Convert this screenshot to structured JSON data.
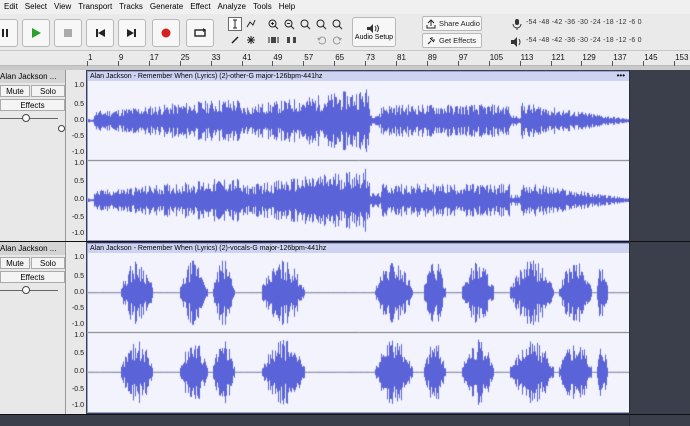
{
  "menu": [
    "Edit",
    "Select",
    "View",
    "Transport",
    "Tracks",
    "Generate",
    "Effect",
    "Analyze",
    "Tools",
    "Help"
  ],
  "menu_underline": [
    "E",
    "S",
    "V",
    "r",
    "T",
    "G",
    "c",
    "A",
    "o",
    "H"
  ],
  "toolbar": {
    "share_audio_label": "Share Audio",
    "get_effects_label": "Get Effects",
    "audio_setup_label": "Audio Setup",
    "meter_scale": "-54  -48  -42  -36  -30  -24  -18  -12   -6    0",
    "meter_scale2": "-54  -48  -42  -36  -30  -24  -18  -12   -6    0"
  },
  "ruler": {
    "labels": [
      "1",
      "9",
      "17",
      "25",
      "33",
      "41",
      "49",
      "57",
      "65",
      "73",
      "81",
      "89",
      "97",
      "105",
      "113",
      "121",
      "129",
      "137",
      "145",
      "153"
    ]
  },
  "tracks": [
    {
      "name": "Alan Jackson ...",
      "mute_label": "Mute",
      "solo_label": "Solo",
      "effects_label": "Effects",
      "clip_title": "Alan Jackson - Remember When (Lyrics) (2)-other-G major-126bpm-441hz",
      "scale": [
        "1.0",
        "0.5",
        "0.0",
        "-0.5",
        "-1.0"
      ],
      "scale2": [
        "1.0",
        "0.5",
        "0.0",
        "-0.5",
        "-1.0"
      ]
    },
    {
      "name": "Alan Jackson ...",
      "mute_label": "Mute",
      "solo_label": "Solo",
      "effects_label": "Effects",
      "clip_title": "Alan Jackson - Remember When (Lyrics) (2)-vocals-G major-126bpm-441hz",
      "scale": [
        "1.0",
        "0.5",
        "0.0",
        "-0.5",
        "-1.0"
      ],
      "scale2": [
        "1.0",
        "0.5",
        "0.0",
        "-0.5",
        "-1.0"
      ]
    }
  ],
  "colors": {
    "waveform": "#5b63d8",
    "clip_bg": "#f2f3fd",
    "play_green": "#2aa12a",
    "record_red": "#d42020"
  }
}
